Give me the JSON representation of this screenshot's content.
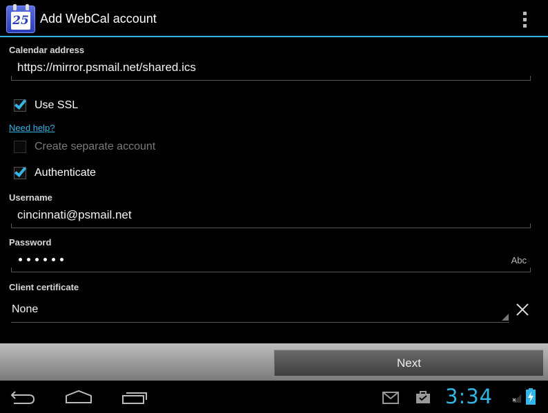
{
  "app": {
    "title": "Add WebCal account",
    "icon_day": "25",
    "icon": "calendar-icon"
  },
  "form": {
    "calendar_address": {
      "label": "Calendar address",
      "value": "https://mirror.psmail.net/shared.ics"
    },
    "use_ssl": {
      "label": "Use SSL",
      "checked": true
    },
    "help_link": "Need help?",
    "separate_account": {
      "label": "Create separate account",
      "checked": false,
      "enabled": false
    },
    "authenticate": {
      "label": "Authenticate",
      "checked": true
    },
    "username": {
      "label": "Username",
      "value": "cincinnati@psmail.net"
    },
    "password": {
      "label": "Password",
      "masked_length": 6,
      "input_hint": "Abc"
    },
    "client_certificate": {
      "label": "Client certificate",
      "value": "None"
    }
  },
  "buttons": {
    "next": "Next"
  },
  "system": {
    "clock": "3:34",
    "notifications": [
      "gmail-icon",
      "shopping-bag-icon"
    ],
    "icons": [
      "back-icon",
      "home-icon",
      "recent-apps-icon",
      "no-signal-icon",
      "battery-charging-icon"
    ]
  },
  "colors": {
    "accent": "#33b5e5",
    "background": "#000000",
    "button_bar": "#9e9e9e"
  }
}
